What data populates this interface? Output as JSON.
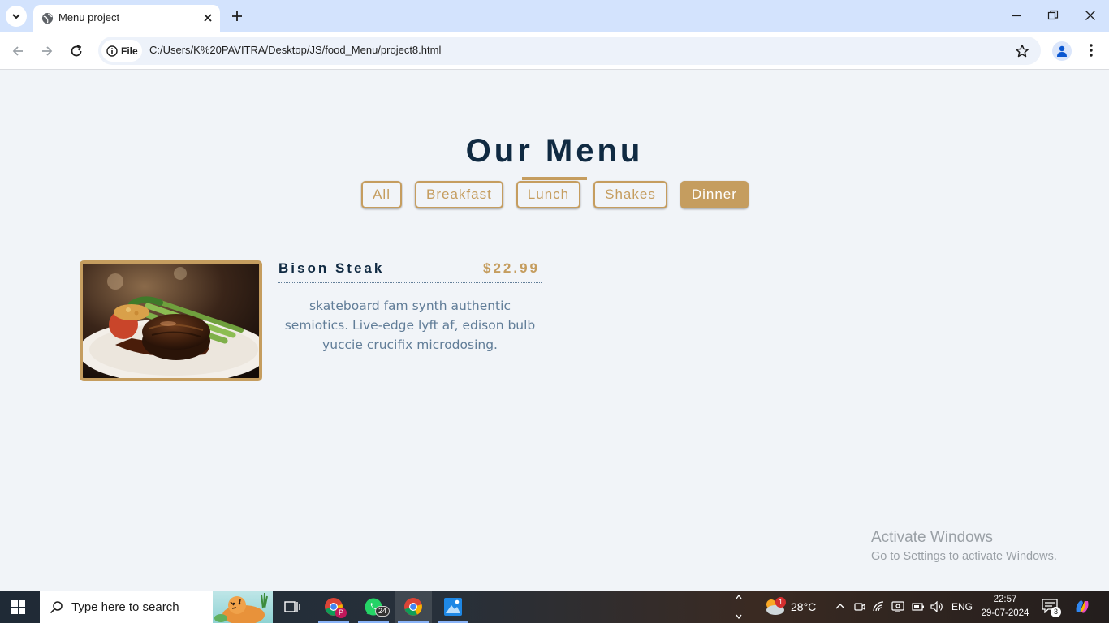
{
  "browser": {
    "tab_title": "Menu project",
    "site_chip": "File",
    "url": "C:/Users/K%20PAVITRA/Desktop/JS/food_Menu/project8.html"
  },
  "page": {
    "title": "Our Menu",
    "filters": [
      "All",
      "Breakfast",
      "Lunch",
      "Shakes",
      "Dinner"
    ],
    "active_filter": "Dinner",
    "items": [
      {
        "name": "Bison Steak",
        "price": "$22.99",
        "description": "skateboard fam synth authentic semiotics. Live-edge lyft af, edison bulb yuccie crucifix microdosing."
      }
    ],
    "colors": {
      "accent": "#c59d5f",
      "heading": "#102a42",
      "text": "#617d98",
      "background": "#f1f4f8"
    }
  },
  "watermark": {
    "title": "Activate Windows",
    "subtitle": "Go to Settings to activate Windows."
  },
  "taskbar": {
    "search_placeholder": "Type here to search",
    "whatsapp_badge": "24",
    "chrome_profile_badge": "P",
    "weather_badge": "1",
    "temperature": "28°C",
    "language": "ENG",
    "time": "22:57",
    "date": "29-07-2024",
    "notifications": "3"
  }
}
